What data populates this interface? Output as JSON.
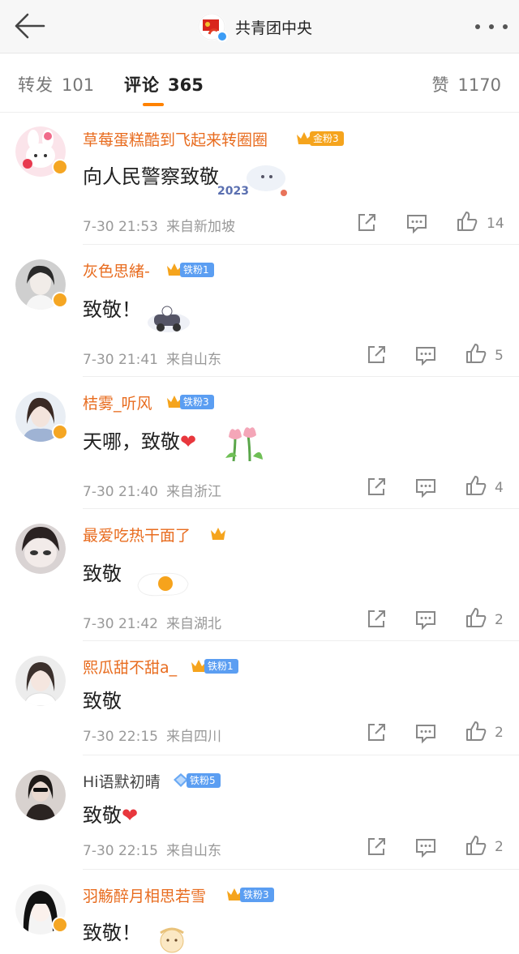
{
  "header": {
    "title": "共青团中央",
    "back_icon": "back-arrow-icon",
    "more_icon": "more-dots-icon"
  },
  "tabs": {
    "repost": {
      "label": "转发",
      "count": "101"
    },
    "comments": {
      "label": "评论",
      "count": "365"
    },
    "likes": {
      "label": "赞",
      "count": "1170"
    }
  },
  "colors": {
    "accent": "#ff8200",
    "username": "#e86c1f",
    "gold_badge": "#f5a41d",
    "iron_badge": "#5b9ef2",
    "heart": "#e8373d"
  },
  "comments": [
    {
      "username": "草莓蛋糕酷到飞起来转圈圈",
      "badge": "金粉3",
      "text": "向人民警察致敬",
      "time": "7-30 21:53",
      "source": "来自新加坡",
      "likes": "14"
    },
    {
      "username": "灰色思緒-",
      "badge": "铁粉1",
      "text": "致敬！",
      "time": "7-30 21:41",
      "source": "来自山东",
      "likes": "5"
    },
    {
      "username": "桔雾_听风",
      "badge": "铁粉3",
      "text": "天哪，致敬",
      "time": "7-30 21:40",
      "source": "来自浙江",
      "likes": "4"
    },
    {
      "username": "最爱吃热干面了",
      "badge": "",
      "text": "致敬",
      "time": "7-30 21:42",
      "source": "来自湖北",
      "likes": "2"
    },
    {
      "username": "熙瓜甜不甜a_",
      "badge": "铁粉1",
      "text": "致敬",
      "time": "7-30 22:15",
      "source": "来自四川",
      "likes": "2"
    },
    {
      "username": "Hi语默初晴",
      "badge": "铁粉5",
      "text": "致敬",
      "time": "7-30 22:15",
      "source": "来自山东",
      "likes": "2"
    },
    {
      "username": "羽觞醉月相思若雪",
      "badge": "铁粉3",
      "text": "致敬！",
      "time": "",
      "source": "",
      "likes": ""
    }
  ],
  "sticker_text": "2023"
}
